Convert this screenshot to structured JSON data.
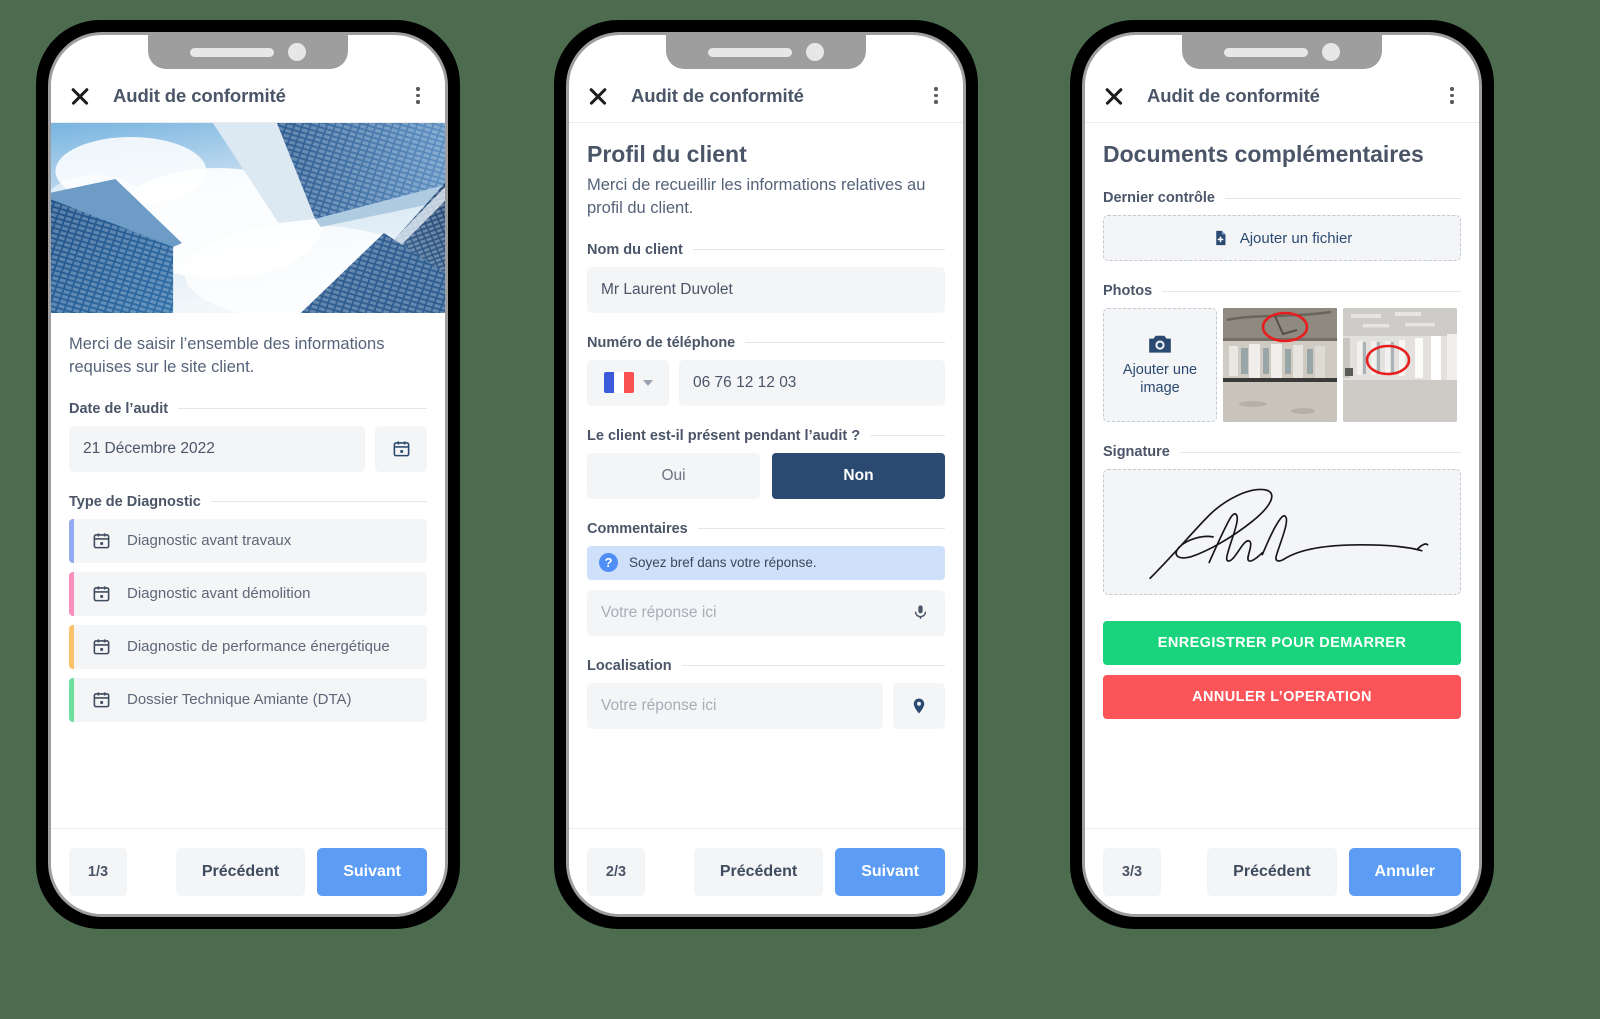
{
  "background_color": "#4c6b4f",
  "accent_colors": {
    "primary_blue": "#5c9cf5",
    "navy": "#2b4a72",
    "green": "#19d47c",
    "red": "#fb5459",
    "hint_blue": "#cfe0fb"
  },
  "appbar": {
    "close_icon": "close-icon",
    "title": "Audit de conformité",
    "menu_icon": "more-vertical-icon"
  },
  "screens": [
    {
      "id": "step-1",
      "hero_image": "skyscrapers-looking-up-photo",
      "intro": "Merci de saisir l’ensemble des informations requises sur le site client.",
      "date_label": "Date de l’audit",
      "date_value": "21 Décembre 2022",
      "date_icon": "calendar-icon",
      "diagnostic_label": "Type de Diagnostic",
      "diagnostics": [
        {
          "label": "Diagnostic avant travaux",
          "color": "#93a9f0",
          "icon": "calendar-icon"
        },
        {
          "label": "Diagnostic avant démolition",
          "color": "#fb8fc0",
          "icon": "calendar-icon"
        },
        {
          "label": "Diagnostic de performance énergétique",
          "color": "#fcc36a",
          "icon": "calendar-icon"
        },
        {
          "label": "Dossier Technique Amiante (DTA)",
          "color": "#6fdf9e",
          "icon": "calendar-icon"
        }
      ],
      "footer": {
        "counter": "1/3",
        "prev": "Précédent",
        "next": "Suivant"
      }
    },
    {
      "id": "step-2",
      "title": "Profil du client",
      "subtitle": "Merci de recueillir les informations relatives au profil du client.",
      "name_label": "Nom du client",
      "name_value": "Mr Laurent Duvolet",
      "phone_label": "Numéro de téléphone",
      "phone_country": "france-flag-icon",
      "phone_value": "06 76 12 12 03",
      "presence_question": "Le client est-il présent pendant l’audit ?",
      "presence_options": [
        {
          "label": "Oui",
          "selected": false
        },
        {
          "label": "Non",
          "selected": true
        }
      ],
      "comments_label": "Commentaires",
      "comments_hint": "Soyez bref dans votre réponse.",
      "comments_hint_icon": "help-circle-icon",
      "comments_placeholder": "Votre réponse ici",
      "comments_action_icon": "microphone-icon",
      "location_label": "Localisation",
      "location_placeholder": "Votre réponse ici",
      "location_action_icon": "map-pin-icon",
      "footer": {
        "counter": "2/3",
        "prev": "Précédent",
        "next": "Suivant"
      }
    },
    {
      "id": "step-3",
      "title": "Documents complémentaires",
      "file_label": "Dernier contrôle",
      "file_button": "Ajouter un fichier",
      "file_button_icon": "file-add-icon",
      "photos_label": "Photos",
      "photos_add_button": "Ajouter une image",
      "photos_add_icon": "camera-icon",
      "photos": [
        {
          "alt": "interior-construction-site-photo-annotated"
        },
        {
          "alt": "empty-office-interior-photo-annotated"
        }
      ],
      "signature_label": "Signature",
      "signature_alt": "handwritten-signature",
      "actions": [
        {
          "label": "ENREGISTRER POUR DEMARRER",
          "style": "green"
        },
        {
          "label": "ANNULER L’OPERATION",
          "style": "red"
        }
      ],
      "footer": {
        "counter": "3/3",
        "prev": "Précédent",
        "next": "Annuler"
      }
    }
  ]
}
